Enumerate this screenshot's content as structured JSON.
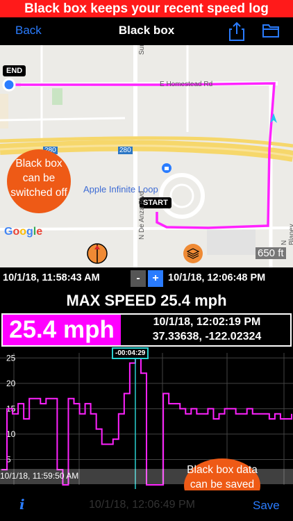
{
  "banner": {
    "text": "Black box keeps your recent speed log"
  },
  "nav": {
    "back": "Back",
    "title": "Black box",
    "share_icon": "share-icon",
    "folder_icon": "folder-icon"
  },
  "map": {
    "end_label": "END",
    "start_label": "START",
    "callout": "Black box can be switched off",
    "road_homestead": "E Homestead Rd",
    "road_280_a": "280",
    "road_280_b": "280",
    "poi": "Apple Infinite Loop",
    "road_deanza": "N De Anza Blvd",
    "road_blaney": "N Blaney Ave",
    "road_top": "Sur",
    "logo": "Google",
    "scale": "650 ft",
    "route_color": "#ff22ff"
  },
  "timebar": {
    "start": "10/1/18, 11:58:43 AM",
    "minus": "-",
    "plus": "+",
    "end": "10/1/18, 12:06:48 PM"
  },
  "summary": {
    "max_speed": "MAX SPEED 25.4 mph"
  },
  "info": {
    "speed": "25.4 mph",
    "datetime": "10/1/18, 12:02:19 PM",
    "coords": "37.33638, -122.02324"
  },
  "chart_data": {
    "type": "line",
    "y_ticks": [
      "25",
      "20",
      "15",
      "10",
      "5"
    ],
    "ylim": [
      0,
      26
    ],
    "cursor_label": "-00:04:29",
    "start_time": "10/1/18, 11:59:50 AM",
    "series": [
      {
        "color": "#ff22ff",
        "values": [
          3,
          15,
          14,
          16,
          13,
          17,
          17,
          16,
          17,
          17,
          3,
          0,
          17,
          16,
          14,
          16,
          14,
          11,
          8,
          8,
          9,
          14,
          18,
          24,
          25,
          22,
          0,
          0,
          0,
          18,
          16,
          16,
          15,
          14,
          15,
          14,
          14,
          15,
          13,
          14,
          15,
          15,
          14,
          14,
          15,
          14,
          14,
          14,
          13,
          14,
          13,
          13,
          14
        ]
      }
    ]
  },
  "chart_callout": "Black box data can be saved",
  "toolbar": {
    "info": "i",
    "datetime": "10/1/18, 12:06:49 PM",
    "save": "Save"
  }
}
